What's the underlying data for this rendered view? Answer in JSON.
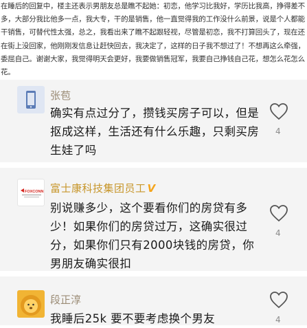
{
  "post": {
    "text": "在睡后的回复中，楼主还表示男朋友总是瞧不起她：初恋，他学习比我好，学历比我高，挣得差不多，大部分我比他多一点，我大专，干的是销售，他一直觉得我的工作没什么前景，说是个人都能干销售，可替代性太强，总之，我看出来了瞧不起跟轻视，尽管是初恋，我不打算回头了，现在还在街上没回家，他刚刚发信息让赶快回去，我决定了，这样的日子我不想过了！不想再这么牵强，委屈自己。谢谢大家，我觉得明天会更好，我要做销售冠军，我要自己挣钱自己花，想怎么花怎么花。"
  },
  "comments": [
    {
      "username": "张苞",
      "avatar_icon": "phone-icon",
      "text": "确实有点过分了，攒钱买房子可以，但是抠成这样，生活还有什么乐趣，只剩买房生娃了吗",
      "likes": "4"
    },
    {
      "username": "富士康科技集团员工",
      "badge": "V",
      "avatar_logo": "FOXCONN",
      "text": "别说赚多少，这个要看你们的房贷有多少！如果你们的房贷过万，这确实很过分，如果你们只有2000块钱的房贷，你男朋友确实很扣",
      "likes": "4"
    },
    {
      "username": "段正淳",
      "avatar_icon": "lion-icon",
      "text": "我睡后25k 要不要考虑换个男友",
      "likes": "4"
    }
  ],
  "colors": {
    "comment_bg": "#f4f4f4",
    "username": "#9b8c76",
    "vip_username": "#c7962b",
    "badge": "#f4a51c",
    "foxconn_red": "#d6261f"
  }
}
